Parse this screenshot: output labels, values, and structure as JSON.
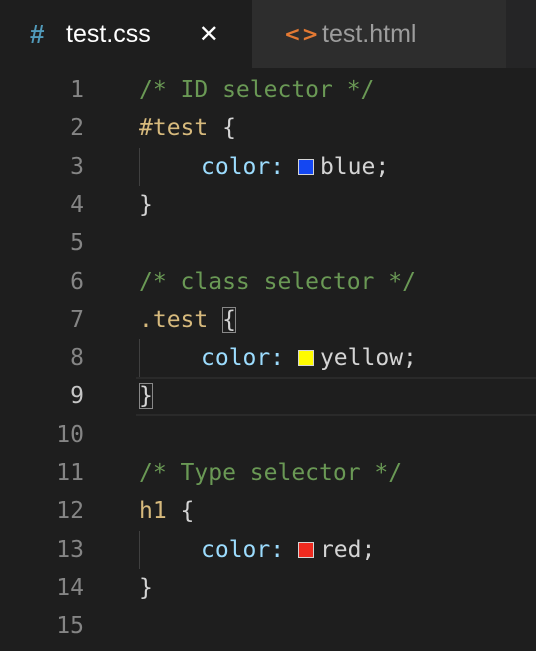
{
  "tabs": [
    {
      "icon": "#",
      "label": "test.css",
      "close": "✕"
    },
    {
      "icon": "<>",
      "label": "test.html"
    }
  ],
  "colors": {
    "blue": "#1447f2",
    "yellow": "#fffb00",
    "red": "#ef2a1f"
  },
  "lines": [
    {
      "num": "1",
      "comment": "/* ID selector */"
    },
    {
      "num": "2",
      "selector": "#test",
      "brace": " {"
    },
    {
      "num": "3",
      "prop": "color:",
      "value": "blue;"
    },
    {
      "num": "4",
      "close": "}"
    },
    {
      "num": "5"
    },
    {
      "num": "6",
      "comment": "/* class selector */"
    },
    {
      "num": "7",
      "selector": ".test",
      "brace": "{"
    },
    {
      "num": "8",
      "prop": "color:",
      "value": "yellow;"
    },
    {
      "num": "9",
      "close": "}"
    },
    {
      "num": "10"
    },
    {
      "num": "11",
      "comment": "/* Type selector */"
    },
    {
      "num": "12",
      "selector": "h1",
      "brace": " {"
    },
    {
      "num": "13",
      "prop": "color:",
      "value": "red;"
    },
    {
      "num": "14",
      "close": "}"
    },
    {
      "num": "15"
    }
  ]
}
